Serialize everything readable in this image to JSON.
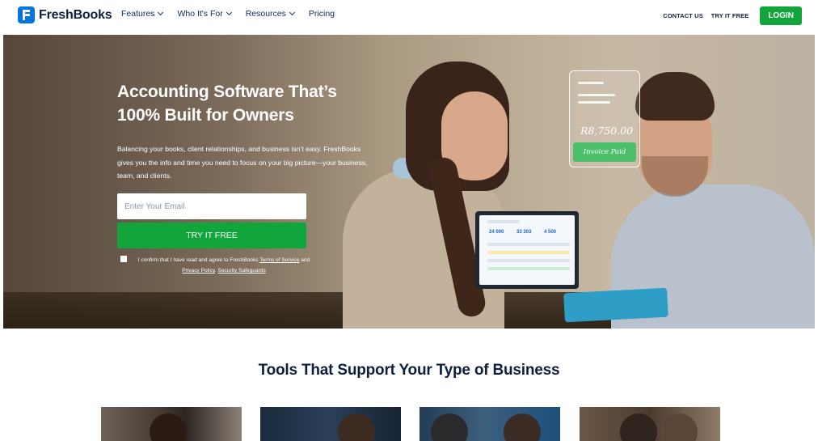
{
  "nav": {
    "brand": "FreshBooks",
    "menu": [
      {
        "label": "Features",
        "has_dropdown": true
      },
      {
        "label": "Who It's For",
        "has_dropdown": true
      },
      {
        "label": "Resources",
        "has_dropdown": true
      },
      {
        "label": "Pricing",
        "has_dropdown": false
      }
    ],
    "contact_label": "CONTACT US",
    "try_label": "TRY IT FREE",
    "login_label": "LOGIN"
  },
  "hero": {
    "title": "Accounting Software That’s 100% Built for Owners",
    "subtitle": "Balancing your books, client relationships, and business isn’t easy. FreshBooks gives you the info and time you need to focus on your big picture—your business, team, and clients.",
    "email_placeholder": "Enter Your Email",
    "cta_label": "TRY IT FREE",
    "consent_prefix": "I confirm that I have read and agree to FreshBooks ",
    "terms_label": "Terms of Service",
    "consent_and": " and ",
    "privacy_label": "Privacy Policy",
    "consent_sep": ". ",
    "security_label": "Security Safeguards",
    "invoice_amount": "R8,750.00",
    "invoice_status": "Invoice Paid",
    "laptop_values": [
      "24 000",
      "33 303",
      "4 500"
    ]
  },
  "tools": {
    "title": "Tools That Support Your Type of Business"
  },
  "colors": {
    "brand_blue": "#0075dd",
    "cta_green": "#12a53c",
    "navy_text": "#0e1f3d"
  }
}
